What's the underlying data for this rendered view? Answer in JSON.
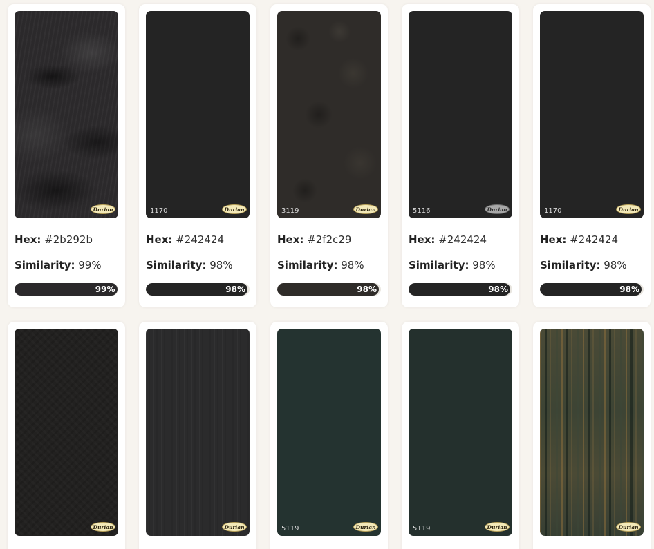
{
  "colors": {
    "page_background": "#f7f4ef",
    "card_background": "#ffffff",
    "logo_badge": "#f3e9b8"
  },
  "cards": [
    {
      "code": "",
      "logo": "Durian",
      "swatch_color": "#2b292b",
      "hex_label": "Hex:",
      "hex": "#2b292b",
      "similarity_label": "Similarity:",
      "similarity": "99%",
      "bar_text": "99%",
      "bar_fraction": 0.99,
      "bar_color": "#2b292b"
    },
    {
      "code": "1170",
      "logo": "Durian",
      "swatch_color": "#242424",
      "hex_label": "Hex:",
      "hex": "#242424",
      "similarity_label": "Similarity:",
      "similarity": "98%",
      "bar_text": "98%",
      "bar_fraction": 0.98,
      "bar_color": "#242424"
    },
    {
      "code": "3119",
      "logo": "Durian",
      "swatch_color": "#2f2c29",
      "hex_label": "Hex:",
      "hex": "#2f2c29",
      "similarity_label": "Similarity:",
      "similarity": "98%",
      "bar_text": "98%",
      "bar_fraction": 0.98,
      "bar_color": "#2f2c29"
    },
    {
      "code": "5116",
      "logo": "Durian",
      "swatch_color": "#242424",
      "hex_label": "Hex:",
      "hex": "#242424",
      "similarity_label": "Similarity:",
      "similarity": "98%",
      "bar_text": "98%",
      "bar_fraction": 0.98,
      "bar_color": "#242424"
    },
    {
      "code": "1170",
      "logo": "Durian",
      "swatch_color": "#242424",
      "hex_label": "Hex:",
      "hex": "#242424",
      "similarity_label": "Similarity:",
      "similarity": "98%",
      "bar_text": "98%",
      "bar_fraction": 0.98,
      "bar_color": "#242424"
    },
    {
      "code": "",
      "logo": "Durian",
      "swatch_color": "#222120"
    },
    {
      "code": "",
      "logo": "Durian",
      "swatch_color": "#2b2b2c"
    },
    {
      "code": "5119",
      "logo": "Durian",
      "swatch_color": "#243330"
    },
    {
      "code": "5119",
      "logo": "Durian",
      "swatch_color": "#24302d"
    },
    {
      "code": "",
      "logo": "Durian",
      "swatch_color": "#3d4434"
    }
  ]
}
